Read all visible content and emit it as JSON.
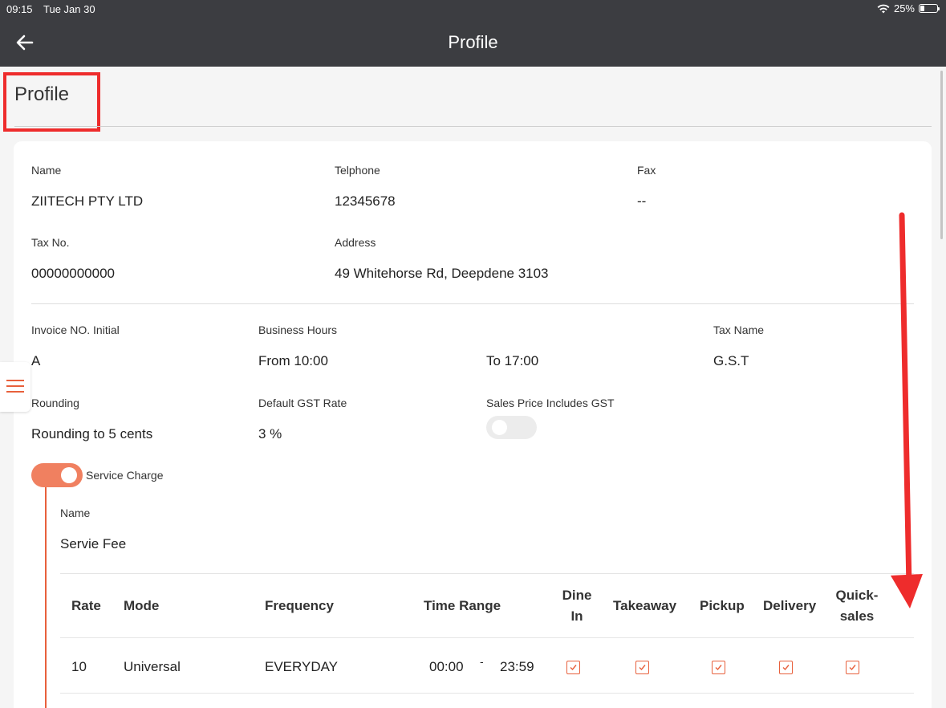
{
  "status": {
    "time": "09:15",
    "date": "Tue Jan 30",
    "battery": "25%",
    "battery_level": 0.25
  },
  "nav": {
    "title": "Profile"
  },
  "page": {
    "title": "Profile"
  },
  "company": {
    "name_label": "Name",
    "name": "ZIITECH PTY LTD",
    "tel_label": "Telphone",
    "tel": "12345678",
    "fax_label": "Fax",
    "fax": "--",
    "tax_label": "Tax No.",
    "tax": "00000000000",
    "address_label": "Address",
    "address": "49 Whitehorse Rd, Deepdene 3103"
  },
  "settings": {
    "invoice_label": "Invoice NO. Initial",
    "invoice": "A",
    "hours_label": "Business Hours",
    "hours_from": "From 10:00",
    "hours_to": "To 17:00",
    "taxname_label": "Tax Name",
    "taxname": "G.S.T",
    "rounding_label": "Rounding",
    "rounding": "Rounding to 5 cents",
    "gst_label": "Default GST Rate",
    "gst": "3 %",
    "includes_gst_label": "Sales Price Includes GST",
    "includes_gst": false
  },
  "service": {
    "toggle_label": "Service Charge",
    "enabled": true,
    "name_label": "Name",
    "name": "Servie Fee",
    "table": {
      "headers": {
        "rate": "Rate",
        "mode": "Mode",
        "frequency": "Frequency",
        "time_range": "Time Range",
        "dine_in_1": "Dine",
        "dine_in_2": "In",
        "takeaway": "Takeaway",
        "pickup": "Pickup",
        "delivery": "Delivery",
        "quick_1": "Quick-",
        "quick_2": "sales"
      },
      "rows": [
        {
          "rate": "10",
          "mode": "Universal",
          "frequency": "EVERYDAY",
          "from": "00:00",
          "sep": "-",
          "to": "23:59",
          "dine_in": true,
          "takeaway": true,
          "pickup": true,
          "delivery": true,
          "quick_sales": true
        }
      ]
    }
  },
  "colors": {
    "accent": "#e8603c",
    "header": "#3c3d41",
    "annotation": "#ee2c2c"
  }
}
